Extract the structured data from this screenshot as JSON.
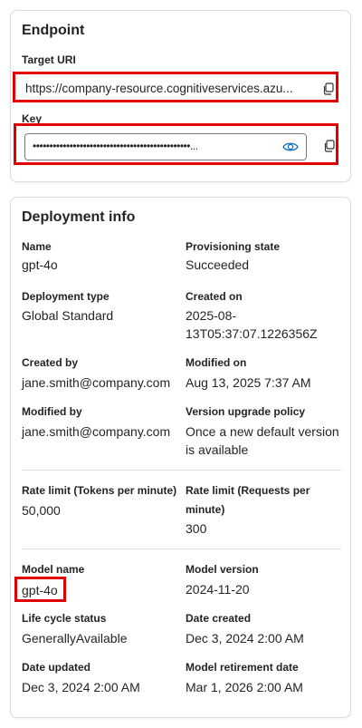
{
  "endpoint": {
    "title": "Endpoint",
    "target_uri_label": "Target URI",
    "target_uri_value": "https://company-resource.cognitiveservices.azu...",
    "key_label": "Key",
    "key_value": "•••••••••••••••••••••••••••••••••••••••••••••••..."
  },
  "deployment": {
    "title": "Deployment info",
    "fields": {
      "name": {
        "label": "Name",
        "value": "gpt-4o"
      },
      "provisioning_state": {
        "label": "Provisioning state",
        "value": "Succeeded"
      },
      "deployment_type": {
        "label": "Deployment type",
        "value": "Global Standard"
      },
      "created_on": {
        "label": "Created on",
        "value_line1": "2025-08-",
        "value_line2": "13T05:37:07.1226356Z"
      },
      "created_by": {
        "label": "Created by",
        "value": "jane.smith@company.com"
      },
      "modified_on": {
        "label": "Modified on",
        "value": "Aug 13, 2025 7:37 AM"
      },
      "modified_by": {
        "label": "Modified by",
        "value": "jane.smith@company.com"
      },
      "version_upgrade_policy": {
        "label": "Version upgrade policy",
        "value_line1": "Once a new default version",
        "value_line2": "is available"
      },
      "rate_limit_tokens": {
        "label": "Rate limit (Tokens per minute)",
        "value": "50,000"
      },
      "rate_limit_requests": {
        "label_line1": "Rate limit (Requests per",
        "label_line2": "minute)",
        "value": "300"
      },
      "model_name": {
        "label": "Model name",
        "value": "gpt-4o"
      },
      "model_version": {
        "label": "Model version",
        "value": "2024-11-20"
      },
      "life_cycle_status": {
        "label": "Life cycle status",
        "value": "GenerallyAvailable"
      },
      "date_created": {
        "label": "Date created",
        "value": "Dec 3, 2024 2:00 AM"
      },
      "date_updated": {
        "label": "Date updated",
        "value": "Dec 3, 2024 2:00 AM"
      },
      "model_retirement_date": {
        "label": "Model retirement date",
        "value": "Mar 1, 2026 2:00 AM"
      }
    }
  },
  "colors": {
    "highlight_border": "#e00000",
    "accent": "#0f6cbd"
  },
  "icons": {
    "copy": "copy-icon",
    "reveal": "eye-icon"
  }
}
